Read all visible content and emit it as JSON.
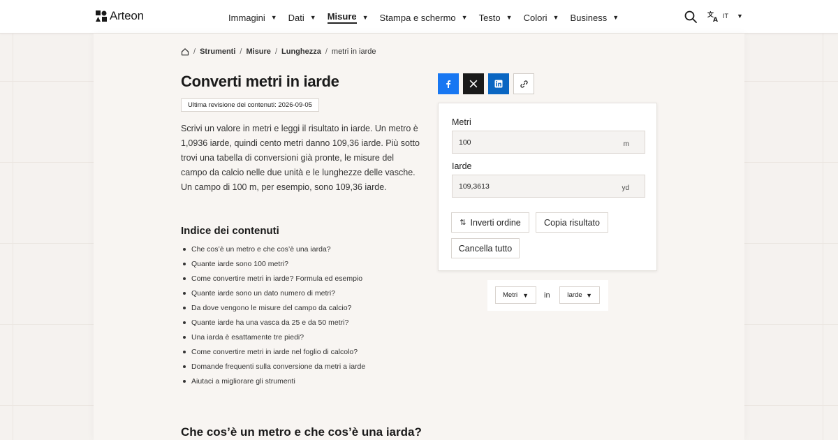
{
  "brand": {
    "name": "Arteon"
  },
  "nav": {
    "items": [
      {
        "label": "Immagini",
        "active": false
      },
      {
        "label": "Dati",
        "active": false
      },
      {
        "label": "Misure",
        "active": true
      },
      {
        "label": "Stampa e schermo",
        "active": false
      },
      {
        "label": "Testo",
        "active": false
      },
      {
        "label": "Colori",
        "active": false
      },
      {
        "label": "Business",
        "active": false
      }
    ],
    "language": "IT"
  },
  "breadcrumb": {
    "items": [
      "Strumenti",
      "Misure",
      "Lunghezza"
    ],
    "current": "metri in iarde"
  },
  "page": {
    "title": "Converti metri in iarde",
    "revision": "Ultima revisione dei contenuti: 2026-09-05",
    "intro": "Scrivi un valore in metri e leggi il risultato in iarde. Un metro è 1,0936 iarde, quindi cento metri danno 109,36 iarde. Più sotto trovi una tabella di conversioni già pronte, le misure del campo da calcio nelle due unità e le lunghezze delle vasche. Un campo di 100 m, per esempio, sono 109,36 iarde.",
    "toc_title": "Indice dei contenuti",
    "toc": [
      "Che cos’è un metro e che cos’è una iarda?",
      "Quante iarde sono 100 metri?",
      "Come convertire metri in iarde? Formula ed esempio",
      "Quante iarde sono un dato numero di metri?",
      "Da dove vengono le misure del campo da calcio?",
      "Quante iarde ha una vasca da 25 e da 50 metri?",
      "Una iarda è esattamente tre piedi?",
      "Come convertire metri in iarde nel foglio di calcolo?",
      "Domande frequenti sulla conversione da metri a iarde",
      "Aiutaci a migliorare gli strumenti"
    ],
    "section_title": "Che cos’è un metro e che cos’è una iarda?"
  },
  "converter": {
    "from_label": "Metri",
    "from_value": "100",
    "from_unit": "m",
    "to_label": "Iarde",
    "to_value": "109,3613",
    "to_unit": "yd",
    "swap_label": "Inverti ordine",
    "copy_label": "Copia risultato",
    "clear_label": "Cancella tutto"
  },
  "unit_selector": {
    "from": "Metri",
    "connector": "in",
    "to": "Iarde"
  },
  "colors": {
    "facebook": "#1877f2",
    "x": "#1a1a1a",
    "linkedin": "#0a66c2",
    "background": "#f5f2ef"
  }
}
